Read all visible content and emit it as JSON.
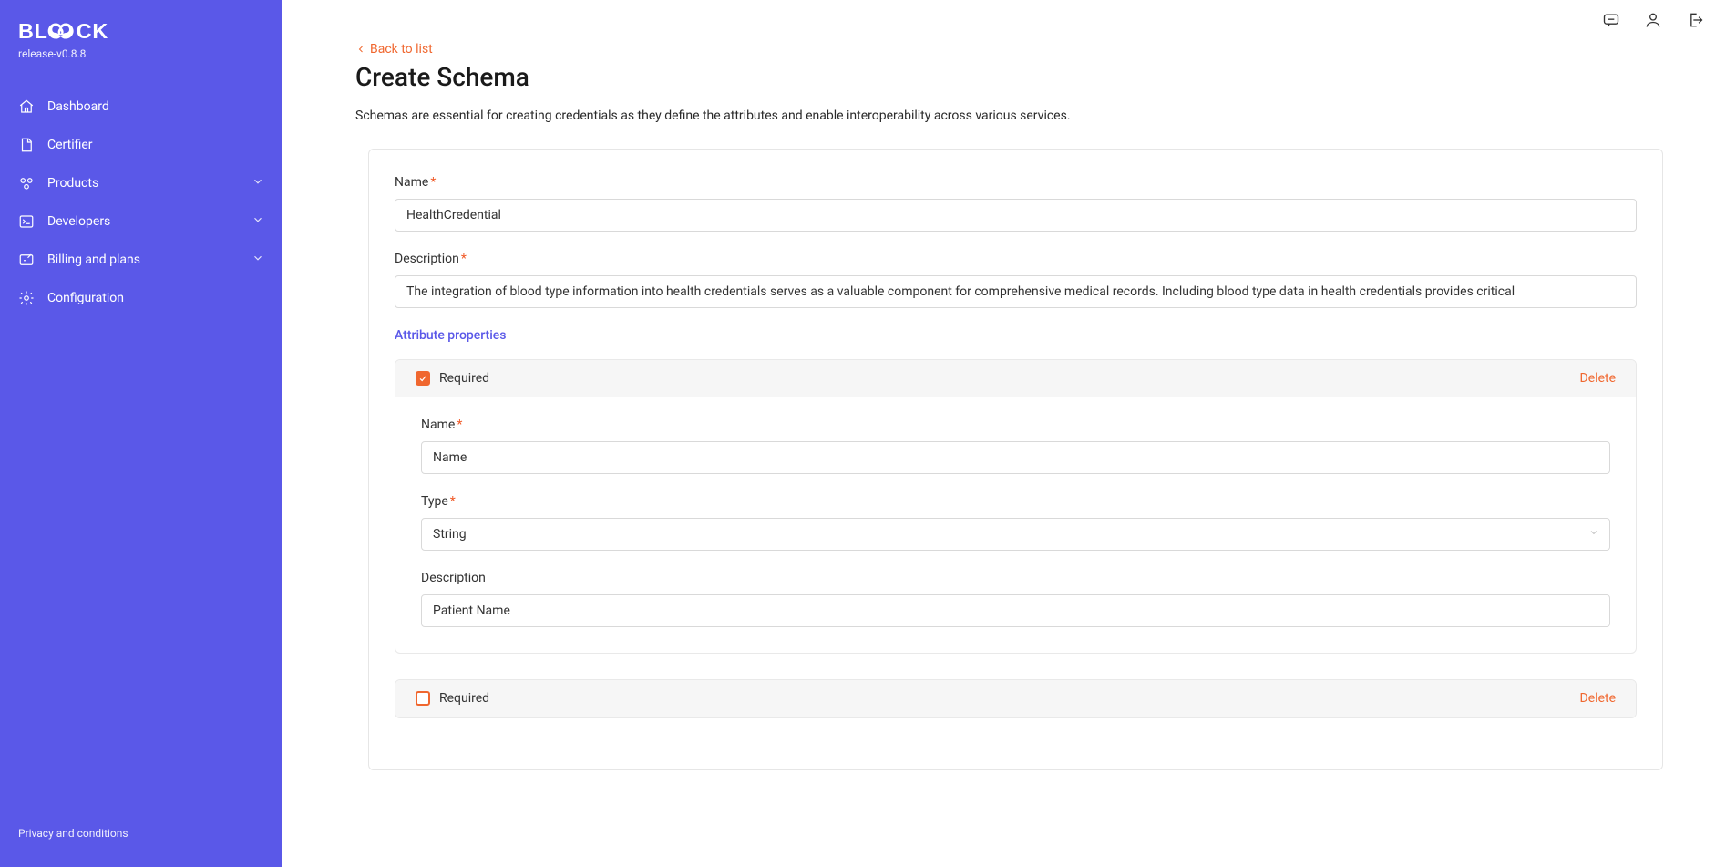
{
  "sidebar": {
    "logo_text": "BLOOCK",
    "release": "release-v0.8.8",
    "items": [
      {
        "label": "Dashboard",
        "icon": "home",
        "expandable": false
      },
      {
        "label": "Certifier",
        "icon": "file",
        "expandable": false
      },
      {
        "label": "Products",
        "icon": "boxes",
        "expandable": true
      },
      {
        "label": "Developers",
        "icon": "terminal",
        "expandable": true
      },
      {
        "label": "Billing and plans",
        "icon": "edit",
        "expandable": true
      },
      {
        "label": "Configuration",
        "icon": "gear",
        "expandable": false
      }
    ],
    "footer": "Privacy and conditions"
  },
  "topbar": {
    "icons": [
      "chat",
      "user",
      "logout"
    ]
  },
  "page": {
    "back_label": "Back to list",
    "title": "Create Schema",
    "subtitle": "Schemas are essential for creating credentials as they define the attributes and enable interoperability across various services."
  },
  "form": {
    "name_label": "Name",
    "name_value": "HealthCredential",
    "desc_label": "Description",
    "desc_value": "The integration of blood type information into health credentials serves as a valuable component for comprehensive medical records. Including blood type data in health credentials provides critical",
    "attr_section_title": "Attribute properties",
    "attributes": [
      {
        "required_checked": true,
        "required_label": "Required",
        "delete_label": "Delete",
        "name_label": "Name",
        "name_value": "Name",
        "type_label": "Type",
        "type_value": "String",
        "desc_label": "Description",
        "desc_value": "Patient Name"
      },
      {
        "required_checked": false,
        "required_label": "Required",
        "delete_label": "Delete"
      }
    ]
  }
}
